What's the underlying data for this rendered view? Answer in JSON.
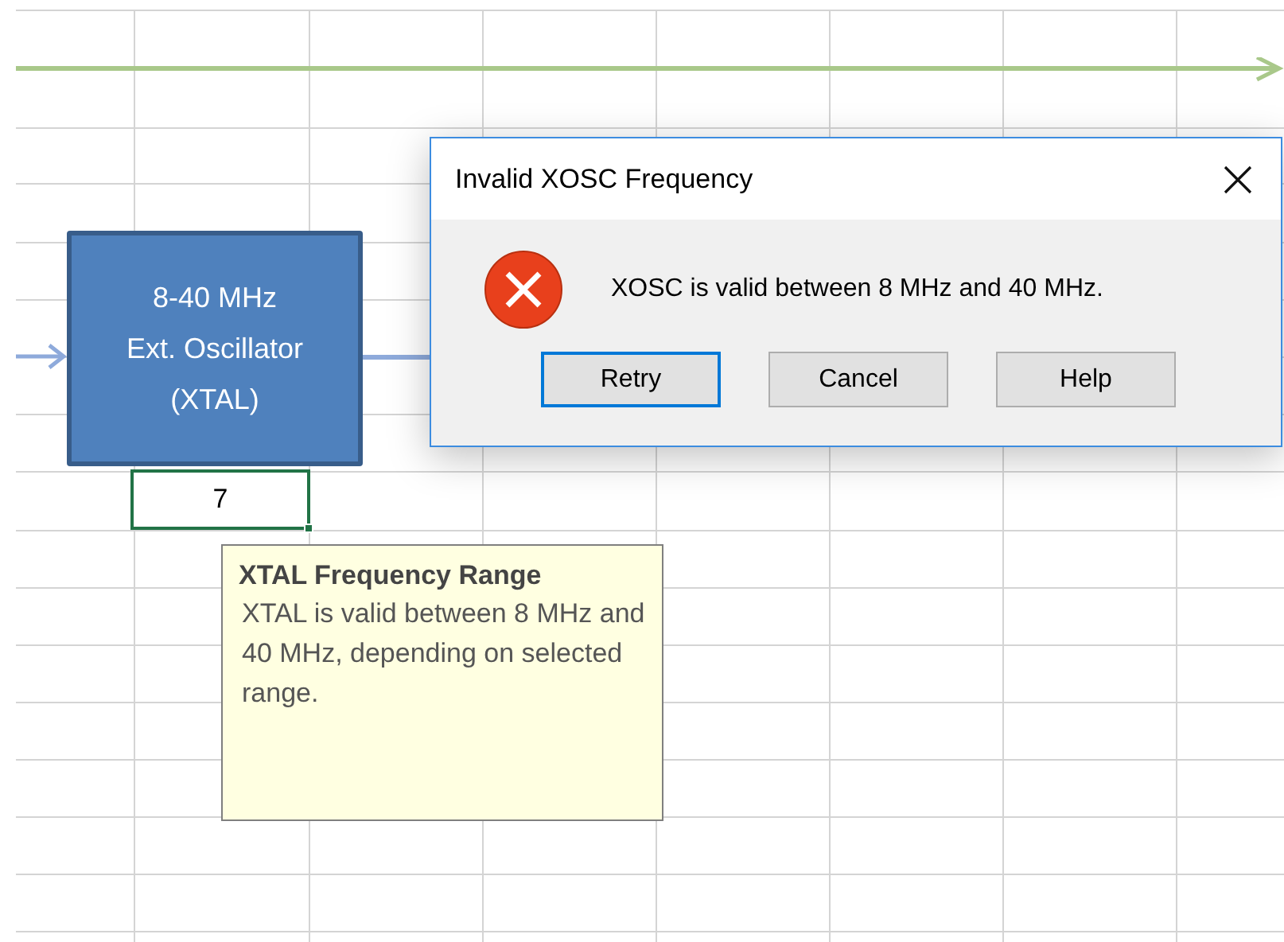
{
  "sheet": {
    "block": {
      "lines": [
        "8-40 MHz",
        "Ext. Oscillator",
        "(XTAL)"
      ]
    },
    "cell": {
      "value": "7",
      "selected": true
    },
    "comment": {
      "title": "XTAL Frequency Range",
      "body": "XTAL is valid between 8 MHz and 40 MHz, depending on selected range."
    }
  },
  "dialog": {
    "title": "Invalid XOSC Frequency",
    "message": "XOSC is valid between 8 MHz and 40 MHz.",
    "buttons": [
      {
        "label": "Retry",
        "focused": true
      },
      {
        "label": "Cancel",
        "focused": false
      },
      {
        "label": "Help",
        "focused": false
      }
    ]
  }
}
